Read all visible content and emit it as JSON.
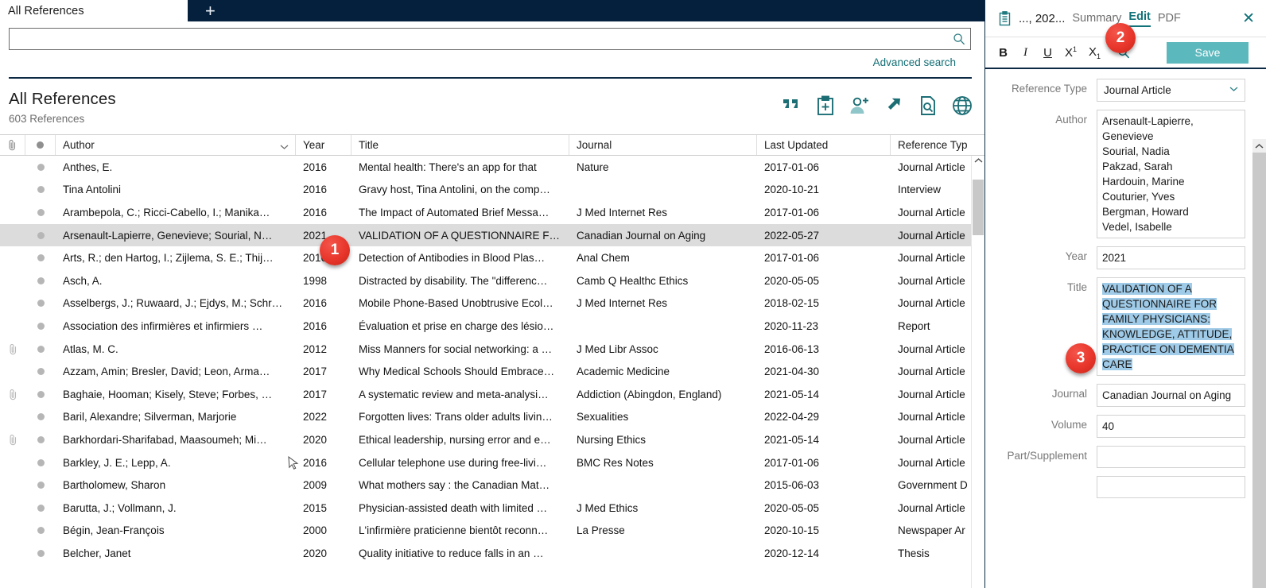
{
  "window": {
    "tab_label": "All References",
    "add_tab_icon": "plus-icon"
  },
  "search": {
    "value": "",
    "placeholder": "",
    "icon": "search-icon",
    "advanced_label": "Advanced search"
  },
  "library_header": {
    "title": "All References",
    "count_label": "603 References",
    "toolbar_icons": [
      {
        "name": "quote-icon",
        "title": "Insert Citation"
      },
      {
        "name": "clipboard-plus-icon",
        "title": "New Reference"
      },
      {
        "name": "add-person-icon",
        "title": "Share"
      },
      {
        "name": "export-arrow-icon",
        "title": "Export"
      },
      {
        "name": "find-full-text-icon",
        "title": "Find Full Text"
      },
      {
        "name": "globe-icon",
        "title": "Online Search"
      }
    ]
  },
  "table": {
    "columns": [
      {
        "key": "attachment",
        "label": "",
        "icon": "paperclip-icon"
      },
      {
        "key": "read",
        "label": "",
        "icon": "dot-icon"
      },
      {
        "key": "author",
        "label": "Author",
        "sort": "chevron-down-icon"
      },
      {
        "key": "year",
        "label": "Year"
      },
      {
        "key": "title",
        "label": "Title"
      },
      {
        "key": "journal",
        "label": "Journal"
      },
      {
        "key": "last_updated",
        "label": "Last Updated"
      },
      {
        "key": "reference_type",
        "label": "Reference Typ"
      }
    ],
    "rows": [
      {
        "clip": false,
        "author": "Anthes, E.",
        "year": "2016",
        "title": "Mental health: There's an app for that",
        "journal": "Nature",
        "updated": "2017-01-06",
        "type": "Journal Article",
        "selected": false
      },
      {
        "clip": false,
        "author": "Tina Antolini",
        "year": "2016",
        "title": "Gravy host, Tina Antolini, on the comp…",
        "journal": "",
        "updated": "2020-10-21",
        "type": "Interview",
        "selected": false
      },
      {
        "clip": false,
        "author": "Arambepola, C.; Ricci-Cabello, I.; Manika…",
        "year": "2016",
        "title": "The Impact of Automated Brief Messa…",
        "journal": "J Med Internet Res",
        "updated": "2017-01-06",
        "type": "Journal Article",
        "selected": false
      },
      {
        "clip": false,
        "author": "Arsenault-Lapierre, Genevieve; Sourial, N…",
        "year": "2021",
        "title": "VALIDATION OF A QUESTIONNAIRE F…",
        "journal": "Canadian Journal on Aging",
        "updated": "2022-05-27",
        "type": "Journal Article",
        "selected": true
      },
      {
        "clip": false,
        "author": "Arts, R.; den Hartog, I.; Zijlema, S. E.; Thij…",
        "year": "2016",
        "title": "Detection of Antibodies in Blood Plas…",
        "journal": "Anal Chem",
        "updated": "2017-01-06",
        "type": "Journal Article",
        "selected": false
      },
      {
        "clip": false,
        "author": "Asch, A.",
        "year": "1998",
        "title": "Distracted by disability. The \"differenc…",
        "journal": "Camb Q Healthc Ethics",
        "updated": "2020-05-05",
        "type": "Journal Article",
        "selected": false
      },
      {
        "clip": false,
        "author": "Asselbergs, J.; Ruwaard, J.; Ejdys, M.; Schr…",
        "year": "2016",
        "title": "Mobile Phone-Based Unobtrusive Ecol…",
        "journal": "J Med Internet Res",
        "updated": "2018-02-15",
        "type": "Journal Article",
        "selected": false
      },
      {
        "clip": false,
        "author": "Association des infirmières et infirmiers …",
        "year": "2016",
        "title": "Évaluation et prise en charge des lésio…",
        "journal": "",
        "updated": "2020-11-23",
        "type": "Report",
        "selected": false
      },
      {
        "clip": true,
        "author": "Atlas, M. C.",
        "year": "2012",
        "title": "Miss Manners for social networking: a …",
        "journal": "J Med Libr Assoc",
        "updated": "2016-06-13",
        "type": "Journal Article",
        "selected": false
      },
      {
        "clip": false,
        "author": "Azzam, Amin; Bresler, David; Leon, Arma…",
        "year": "2017",
        "title": "Why Medical Schools Should Embrace…",
        "journal": "Academic Medicine",
        "updated": "2021-04-30",
        "type": "Journal Article",
        "selected": false
      },
      {
        "clip": true,
        "author": "Baghaie, Hooman; Kisely, Steve; Forbes, …",
        "year": "2017",
        "title": "A systematic review and meta-analysi…",
        "journal": "Addiction (Abingdon, England)",
        "updated": "2021-05-14",
        "type": "Journal Article",
        "selected": false
      },
      {
        "clip": false,
        "author": "Baril, Alexandre; Silverman, Marjorie",
        "year": "2022",
        "title": "Forgotten lives: Trans older adults livin…",
        "journal": "Sexualities",
        "updated": "2022-04-29",
        "type": "Journal Article",
        "selected": false
      },
      {
        "clip": true,
        "author": "Barkhordari-Sharifabad, Maasoumeh; Mi…",
        "year": "2020",
        "title": "Ethical leadership, nursing error and e…",
        "journal": "Nursing Ethics",
        "updated": "2021-05-14",
        "type": "Journal Article",
        "selected": false
      },
      {
        "clip": false,
        "author": "Barkley, J. E.; Lepp, A.",
        "year": "2016",
        "title": "Cellular telephone use during free-livi…",
        "journal": "BMC Res Notes",
        "updated": "2017-01-06",
        "type": "Journal Article",
        "selected": false
      },
      {
        "clip": false,
        "author": "Bartholomew, Sharon",
        "year": "2009",
        "title": "What mothers say : the Canadian Mat…",
        "journal": "",
        "updated": "2015-06-03",
        "type": "Government D",
        "selected": false
      },
      {
        "clip": false,
        "author": "Barutta, J.; Vollmann, J.",
        "year": "2015",
        "title": "Physician-assisted death with limited …",
        "journal": "J Med Ethics",
        "updated": "2020-05-05",
        "type": "Journal Article",
        "selected": false
      },
      {
        "clip": false,
        "author": "Bégin, Jean-François",
        "year": "2000",
        "title": "L'infirmière praticienne bientôt reconn…",
        "journal": "La Presse",
        "updated": "2020-10-15",
        "type": "Newspaper Ar",
        "selected": false
      },
      {
        "clip": false,
        "author": "Belcher, Janet",
        "year": "2020",
        "title": "Quality initiative to reduce falls in an …",
        "journal": "",
        "updated": "2020-12-14",
        "type": "Thesis",
        "selected": false
      }
    ]
  },
  "panel": {
    "reference_title": "..., 202...",
    "clipboard_icon": "clipboard-icon",
    "tabs": [
      {
        "label": "Summary",
        "active": false
      },
      {
        "label": "Edit",
        "active": true
      },
      {
        "label": "PDF",
        "active": false
      }
    ],
    "close_icon": "close-icon",
    "format_toolbar": {
      "bold": "B",
      "italic": "I",
      "underline": "U",
      "superscript_base": "X",
      "superscript_exp": "1",
      "subscript_base": "X",
      "subscript_exp": "1",
      "search_icon": "search-icon",
      "save_label": "Save"
    },
    "fields": {
      "reference_type_label": "Reference Type",
      "reference_type_value": "Journal Article",
      "author_label": "Author",
      "author_value": "Arsenault-Lapierre, Genevieve\nSourial, Nadia\nPakzad, Sarah\nHardouin, Marine\nCouturier, Yves\nBergman, Howard\nVedel, Isabelle",
      "year_label": "Year",
      "year_value": "2021",
      "title_label": "Title",
      "title_value": "VALIDATION OF A QUESTIONNAIRE FOR FAMILY PHYSICIANS: KNOWLEDGE, ATTITUDE, PRACTICE ON DEMENTIA CARE",
      "journal_label": "Journal",
      "journal_value": "Canadian Journal on Aging",
      "volume_label": "Volume",
      "volume_value": "40",
      "part_label": "Part/Supplement",
      "part_value": ""
    }
  },
  "annotations": [
    {
      "id": "1",
      "number": "1"
    },
    {
      "id": "2",
      "number": "2"
    },
    {
      "id": "3",
      "number": "3"
    }
  ],
  "colors": {
    "navy": "#04203c",
    "teal": "#11727a",
    "save_teal": "#5bb8bd",
    "selection_blue": "#9fcbe8",
    "row_selected": "#dcdcdc",
    "badge_red": "#e8362b"
  }
}
